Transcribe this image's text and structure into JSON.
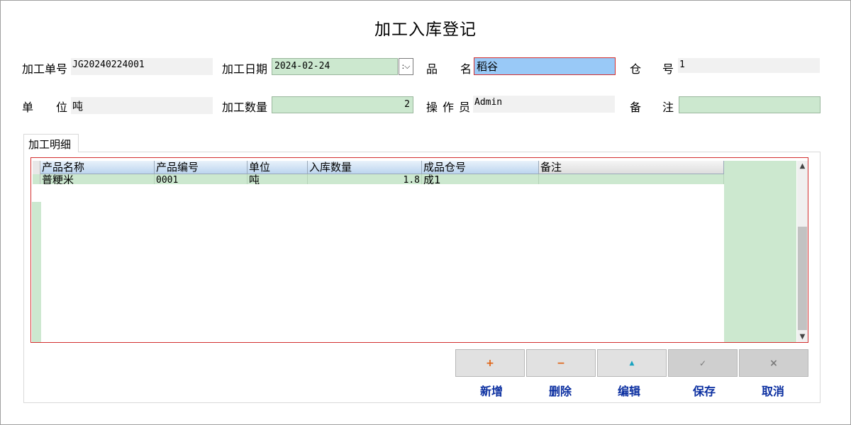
{
  "window": {
    "title": "加工入库登记"
  },
  "form": {
    "order_no": {
      "label": "加工单号",
      "value": "JG20240224001"
    },
    "date": {
      "label": "加工日期",
      "value": "2024-02-24"
    },
    "product_name": {
      "label_a": "品",
      "label_b": "名",
      "value": "稻谷"
    },
    "warehouse_no": {
      "label_a": "仓",
      "label_b": "号",
      "value": "1"
    },
    "unit": {
      "label_a": "单",
      "label_b": "位",
      "value": "吨"
    },
    "quantity": {
      "label": "加工数量",
      "value": "2"
    },
    "operator": {
      "label": "操作员",
      "value": "Admin"
    },
    "remark": {
      "label_a": "备",
      "label_b": "注",
      "value": ""
    }
  },
  "detail": {
    "tab_label": "加工明细",
    "columns": [
      "产品名称",
      "产品编号",
      "单位",
      "入库数量",
      "成品仓号",
      "备注"
    ],
    "rows": [
      {
        "name": "普粳米",
        "code": "0001",
        "unit": "吨",
        "qty": "1.8",
        "warehouse": "成1",
        "remark": ""
      }
    ]
  },
  "buttons": [
    {
      "label": "新增",
      "icon": "plus-icon",
      "glyph": "+",
      "color": "#e06010",
      "enabled": true
    },
    {
      "label": "删除",
      "icon": "minus-icon",
      "glyph": "−",
      "color": "#e06010",
      "enabled": true
    },
    {
      "label": "编辑",
      "icon": "triangle-up-icon",
      "glyph": "▲",
      "color": "#1aa3c0",
      "enabled": true
    },
    {
      "label": "保存",
      "icon": "check-icon",
      "glyph": "✓",
      "color": "#7a7a7a",
      "enabled": false
    },
    {
      "label": "取消",
      "icon": "close-icon",
      "glyph": "×",
      "color": "#7a7a7a",
      "enabled": false
    }
  ],
  "colors": {
    "editable_bg": "#cce8cf",
    "selected_bg": "#99c9f7",
    "focus_border": "#d32f2f",
    "button_label": "#0a2ea0"
  }
}
